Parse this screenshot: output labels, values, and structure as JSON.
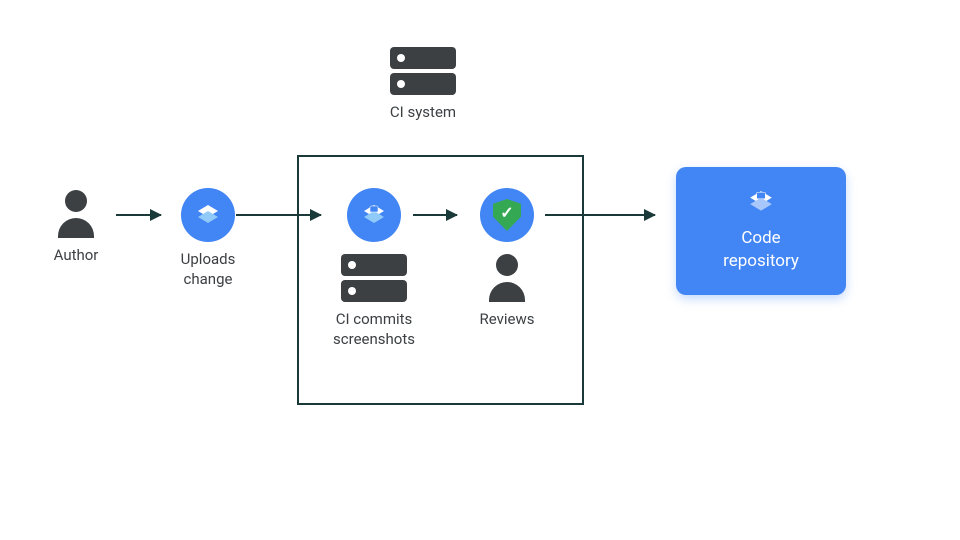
{
  "author": {
    "label": "Author"
  },
  "uploads": {
    "label": "Uploads\nchange"
  },
  "ci_system": {
    "label": "CI system"
  },
  "ci_commits": {
    "label": "CI commits\nscreenshots"
  },
  "reviews": {
    "label": "Reviews"
  },
  "repo": {
    "label": "Code\nrepository"
  },
  "colors": {
    "blue": "#4285f4",
    "green": "#34a853",
    "dark": "#3c4043"
  }
}
